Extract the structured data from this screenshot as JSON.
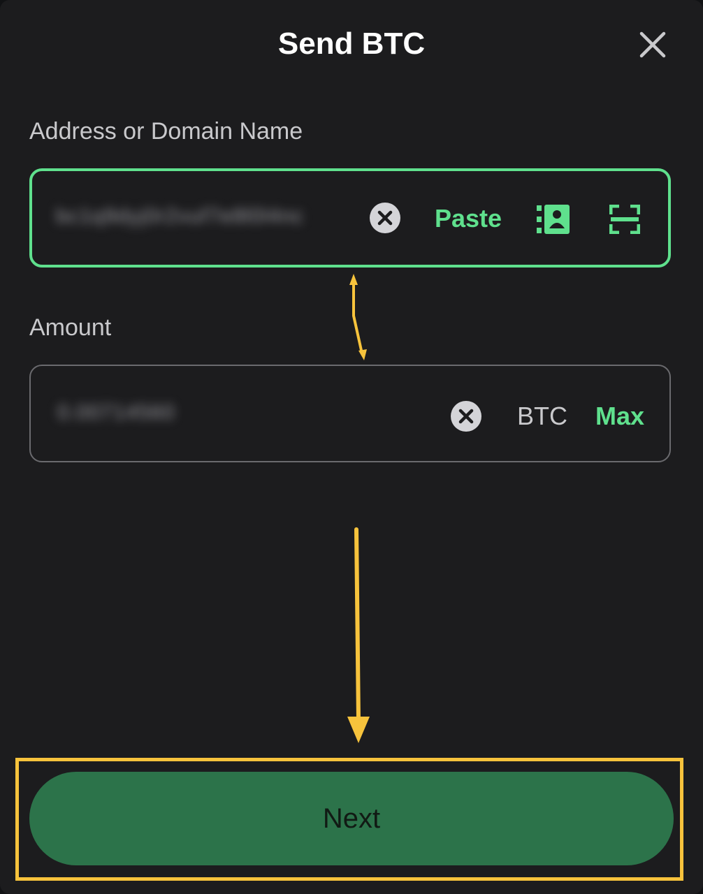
{
  "header": {
    "title": "Send BTC",
    "close_icon": "close-icon"
  },
  "address": {
    "label": "Address or Domain Name",
    "value": "bc1q9dyj0r2vuf7e8l0l4nc",
    "clear_icon": "clear-circle-icon",
    "paste_label": "Paste",
    "contacts_icon": "address-book-icon",
    "scan_icon": "scan-qr-icon"
  },
  "amount": {
    "label": "Amount",
    "value": "0.00714560",
    "clear_icon": "clear-circle-icon",
    "unit": "BTC",
    "max_label": "Max"
  },
  "footer": {
    "next_label": "Next"
  },
  "colors": {
    "background": "#1c1c1e",
    "accent_green": "#5fe08d",
    "button_green": "#2c734a",
    "annotation_yellow": "#f7c33c"
  }
}
